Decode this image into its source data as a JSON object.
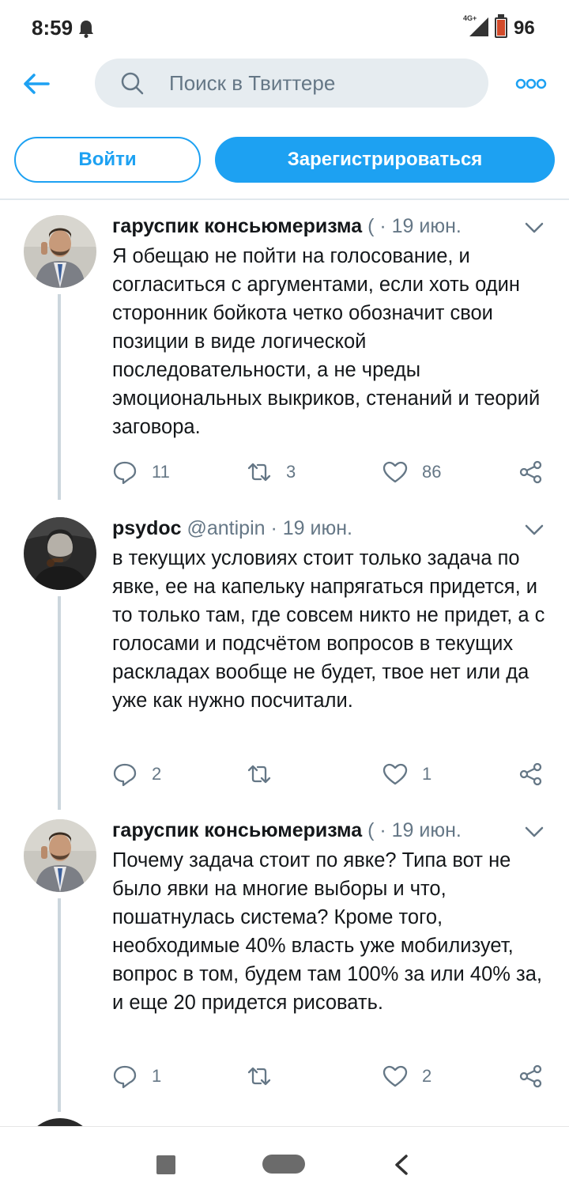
{
  "status_bar": {
    "time": "8:59",
    "network": "4G+",
    "battery_level": "96"
  },
  "header": {
    "search_placeholder": "Поиск в Твиттере"
  },
  "auth": {
    "login_label": "Войти",
    "signup_label": "Зарегистрироваться"
  },
  "colors": {
    "accent": "#1da1f2",
    "text": "#14171a",
    "muted": "#657786",
    "thread_line": "#ccd6dd"
  },
  "tweets": [
    {
      "name": "гаруспик консьюмеризма",
      "handle": "(",
      "separator": "·",
      "date": "19 июн.",
      "text": "Я обещаю не пойти на голосование, и согласиться с аргументами, если хоть один сторонник бойкота четко обозначит свои позиции в виде логической последовательности, а не чреды эмоциональных выкриков, стенаний и теорий заговора.",
      "replies": "11",
      "retweets": "3",
      "likes": "86"
    },
    {
      "name": "psydoc",
      "handle": "@antipin",
      "separator": "·",
      "date": "19 июн.",
      "text": "в текущих условиях стоит только задача по явке, ее на капельку напрягаться придется, и то только там, где совсем никто не придет, а с голосами и подсчётом вопросов в текущих раскладах вообще не будет, твое нет или да уже как нужно посчитали.",
      "replies": "2",
      "retweets": "",
      "likes": "1"
    },
    {
      "name": "гаруспик консьюмеризма",
      "handle": "(",
      "separator": "·",
      "date": "19 июн.",
      "text": "Почему задача стоит по явке? Типа вот не было явки на многие выборы и что, пошатнулась система? Кроме того, необходимые 40% власть уже мобилизует, вопрос в том, будем там 100% за или 40% за, и еще 20 придется рисовать.",
      "replies": "1",
      "retweets": "",
      "likes": "2"
    }
  ]
}
